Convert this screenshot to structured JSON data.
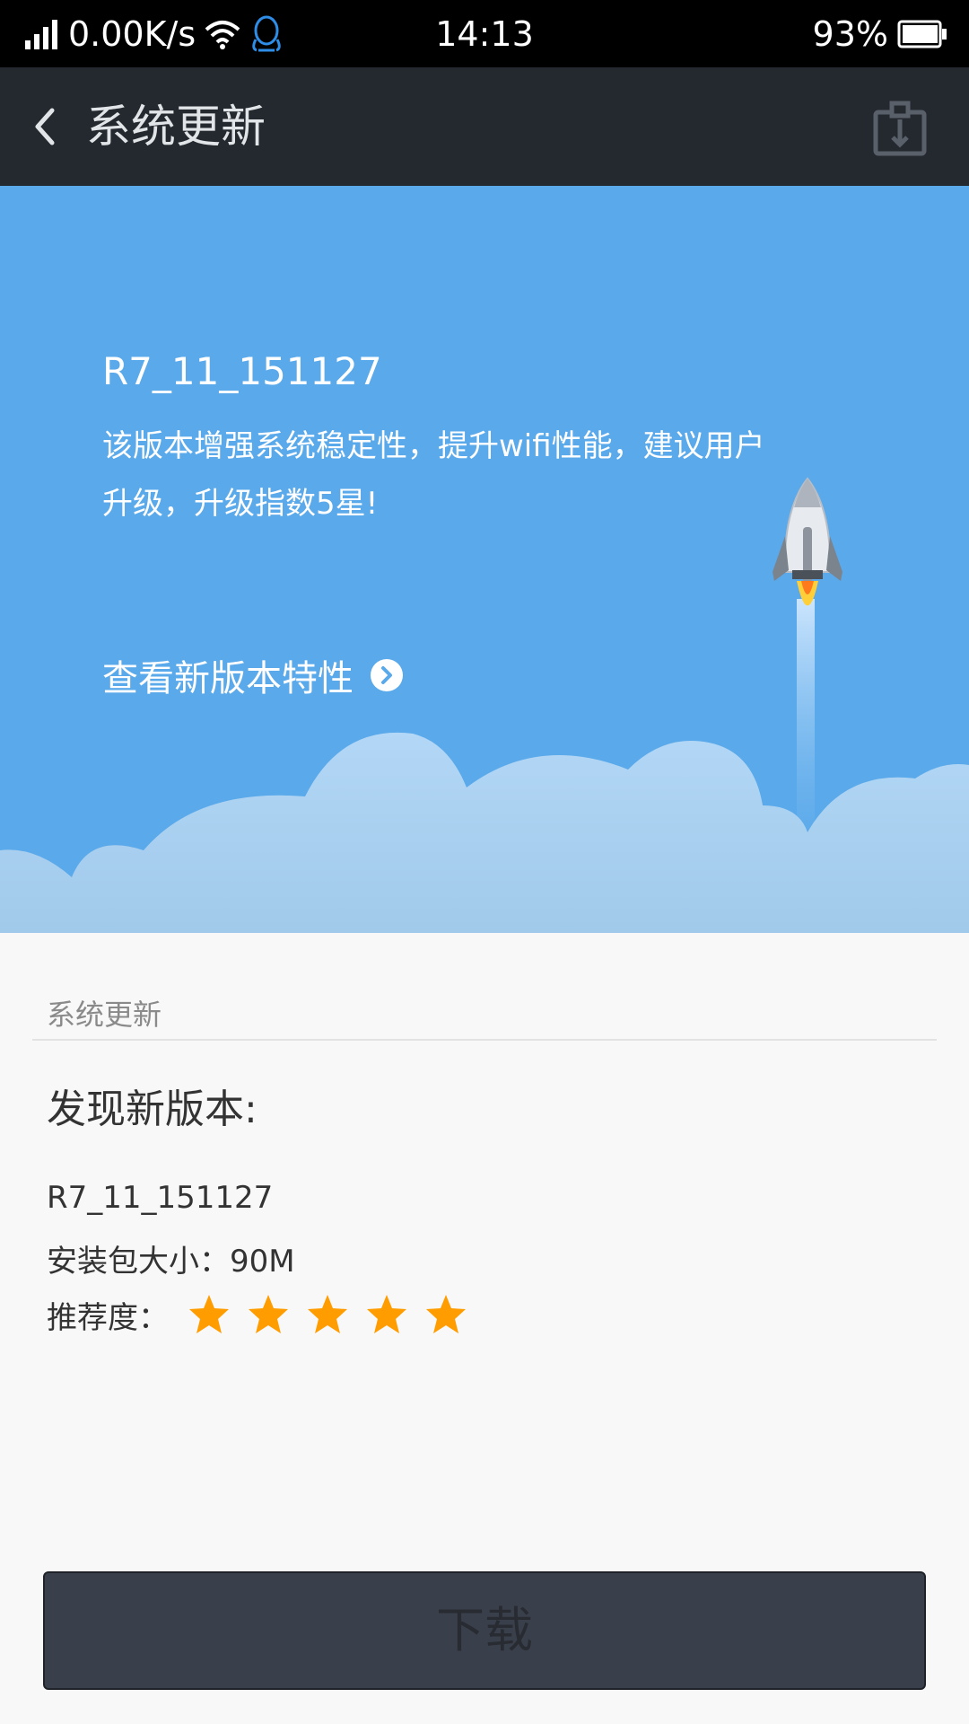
{
  "status_bar": {
    "net_speed": "0.00K/s",
    "time": "14:13",
    "battery": "93%",
    "icons": [
      "signal-icon",
      "wifi-icon",
      "qq-icon",
      "battery-icon"
    ]
  },
  "toolbar": {
    "title": "系统更新",
    "back_icon": "back-arrow-icon",
    "action_icon": "package-tools-icon"
  },
  "hero": {
    "version": "R7_11_151127",
    "description": "该版本增强系统稳定性，提升wifi性能，建议用户升级，升级指数5星!",
    "feature_link": "查看新版本特性"
  },
  "details": {
    "section_label": "系统更新",
    "found_title": "发现新版本:",
    "version": "R7_11_151127",
    "size_text": "安装包大小：90M",
    "recommend_label": "推荐度：",
    "stars": 5
  },
  "download_button": "下载",
  "colors": {
    "hero_bg": "#5aa9ea",
    "toolbar_bg": "#242930",
    "star": "#ff9d00",
    "button_bg": "#3a404b"
  }
}
